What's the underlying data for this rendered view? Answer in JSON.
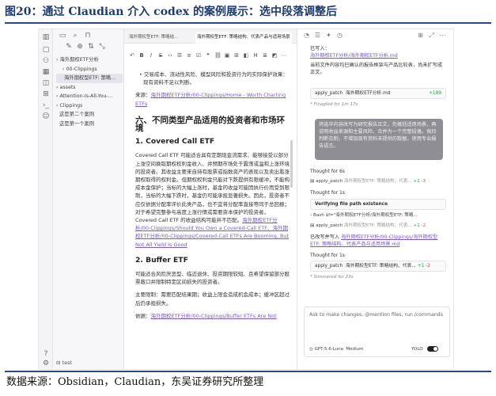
{
  "figure": {
    "title": "图20：通过 Claudian 介入 codex 的案例展示：选中段落调整后",
    "source": "数据来源：Obsidian，Claudian，东吴证券研究所整理"
  },
  "file_explorer": {
    "items": [
      {
        "label": "› 海外期权ETF分析",
        "indent": 0,
        "selected": false
      },
      {
        "label": "› 00-Clippings",
        "indent": 8,
        "selected": false
      },
      {
        "label": "海外期权型ETF: 策略...",
        "indent": 10,
        "selected": true
      },
      {
        "label": "› assets",
        "indent": 0,
        "selected": false
      },
      {
        "label": "› Attention-Is-All-You-...",
        "indent": 0,
        "selected": false
      },
      {
        "label": "› Clippings",
        "indent": 0,
        "selected": false
      },
      {
        "label": "这是第二个案例",
        "indent": 4,
        "selected": false
      },
      {
        "label": "这是第一个案例",
        "indent": 4,
        "selected": false
      }
    ],
    "vault_name": "test"
  },
  "editor": {
    "tabs": [
      "海外期权型ETF: 策略结...",
      "海外期权型ETF: 策略结构、代表产品与适用场景"
    ],
    "content": {
      "top_bullet": "交易成本、流动性风险、模型风险和投资行为的实际保护效果：现有资料不足以判断。",
      "source_label": "来源：",
      "source_link": "海外期权ETF分析/00-Clippings/Home - Worth Charting ETFs",
      "h2": "六、不同类型产品适用的投资者和市场环境",
      "h3a": "1. Covered Call ETF",
      "p1": "Covered Call ETF 可能适合具有定期现金流需求、能够接受以部分上涨空间换取期权权利金收入、并预期市场处于震荡或温和上涨环境的投资者。其收益主要来自持有股票或指数资产的表现以及卖出看涨期权取得的权利金。但期权权利金只能对下跌提供有限缓冲，不能构成本金保护；当标的大幅上涨时，基金的收益可能因执行价而受到限制，当标的大幅下跌时，基金仍可能承担显著损失。因此，投资者不应仅依据分配率评价此类产品，也不宜将分配率直接等同于总回报；对于希望完整参与高度上涨行情或需要资本保护的投资者，Covered Call ETF 的收益结构可能并不匹配。",
      "p1_links": "海外期权ETF分析/00-Clippings/Should You Own a Covered-Call ETF、海外期权ETF分析/00-Clippings/Covered-Call ETFs Are Booming, But Not All Yield Is Good",
      "h3b": "2. Buffer ETF",
      "p2": "可能适合风险厌恶型、临近退休、投资期限较短、且希望保留部分股票敞口并限制特定区间损失的投资者。",
      "p3": "主要限制：需要匹配结果期；收益上限会造成机会成本；缓冲区超过后仍承担损失。",
      "p4_label": "依据：",
      "p4_link": "海外期权ETF分析/00-Clippings/Buffer ETFs Are Not"
    }
  },
  "claudian": {
    "written_label": "已写入：",
    "written_link": "海外期权ETF分析/海外期权ETF分析.md",
    "written_desc": "当前文件内容均已确认的报告框架与产品比较表，尚未扩写成正文。",
    "patch1": {
      "name": "apply_patch",
      "file": "海外期权ETF分析.md",
      "add": "+189"
    },
    "finagled": "* Finagled for 1m 17s",
    "user_message": "将选中内容改写为研究报告正文，先概括适用场景，再说明收益来源和主要风险，合并为一个完整段落。保持判断克制，不增加现有资料未提供的数据，使用专业报告语言。",
    "think1": "Thought for 6s",
    "patch2": {
      "name": "apply_patch",
      "file": "海外期权型ETF: 策略结构、代表...",
      "add": "+1",
      "del": "-3"
    },
    "think2": "Thought for 1s",
    "verify_label": "Verifying file path existence",
    "bash_line": "Bash  $f=\"海外期权ETF分析/海外期权型ETF: 策略...",
    "patch3": {
      "name": "apply_patch",
      "file": "海外期权型ETF: 策略结构、代表...",
      "add": "+1",
      "del": "-2"
    },
    "final_label": "已改写并写入",
    "final_link": "海外期权ETF分析/00-Clippings/海外期权型ETF: 策略结构、代表产品与适用场景.md",
    "think3": "Thought for 1s",
    "patch4": {
      "name": "apply_patch",
      "file": "海外期权型ETF: 策略结构、代表...",
      "add": "+1",
      "del": "-2"
    },
    "simmered": "* Simmered for 23s",
    "input_placeholder": "Ask to make changes, @mention files, run /commands",
    "model": "GPT-5.6-Luna",
    "effort": "Medium",
    "yolo": "YOLO"
  }
}
